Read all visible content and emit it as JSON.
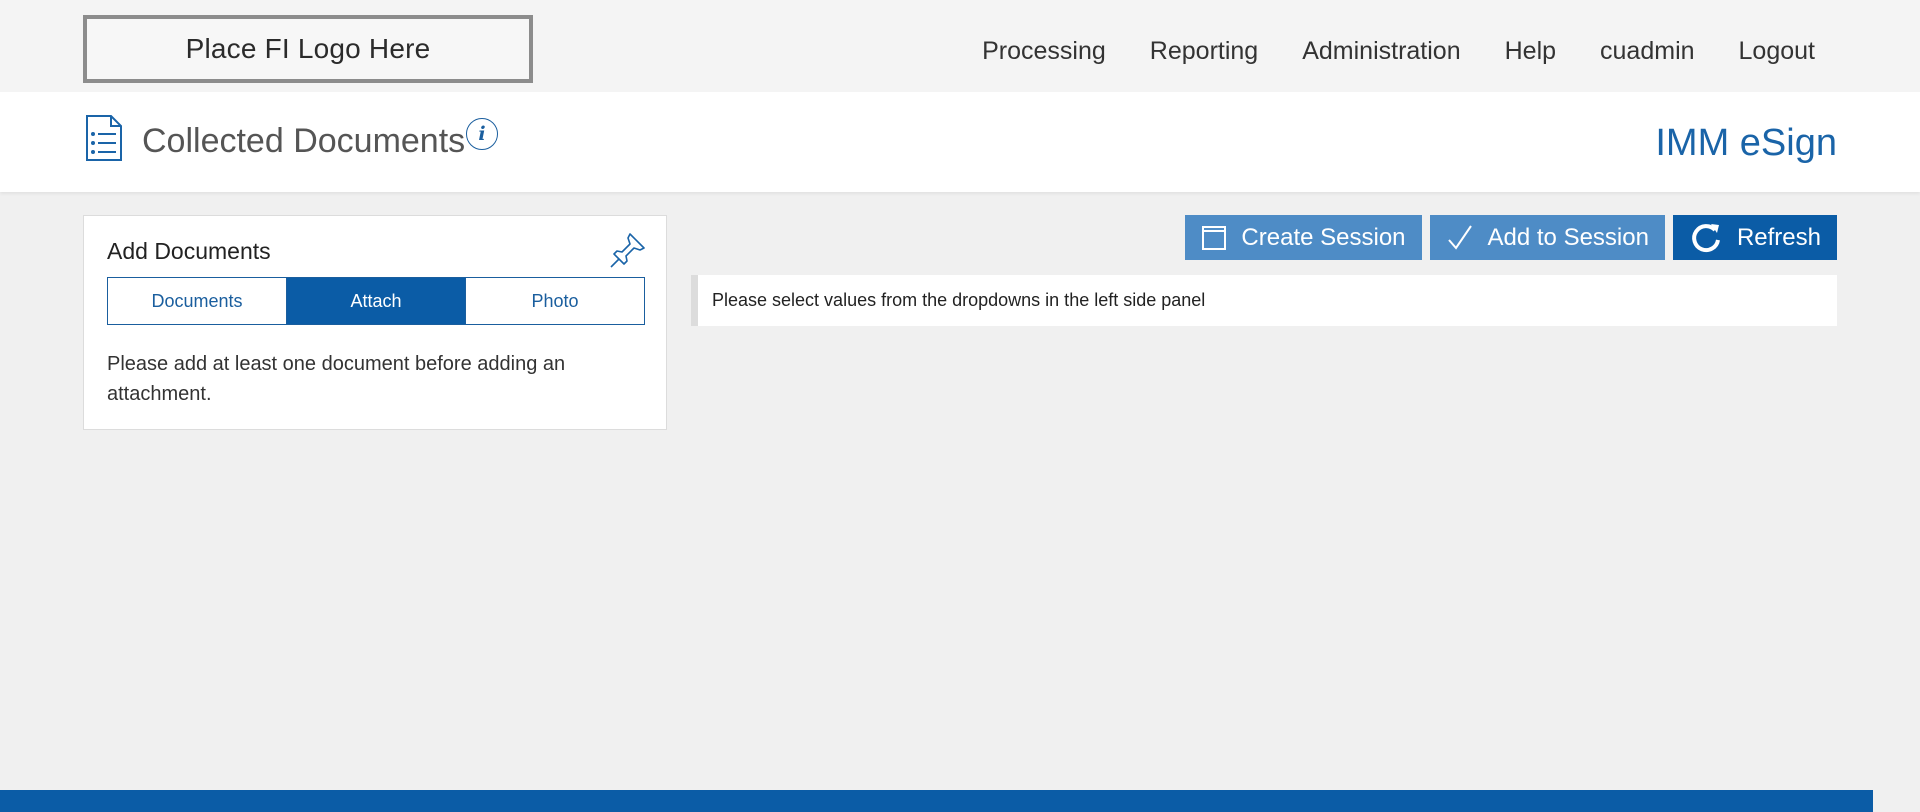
{
  "header": {
    "logo_text": "Place FI Logo Here",
    "nav": [
      {
        "label": "Processing"
      },
      {
        "label": "Reporting"
      },
      {
        "label": "Administration"
      },
      {
        "label": "Help"
      },
      {
        "label": "cuadmin"
      },
      {
        "label": "Logout"
      }
    ]
  },
  "page": {
    "title": "Collected Documents",
    "info_icon": "info-icon",
    "brand": "IMM eSign"
  },
  "panel": {
    "title": "Add Documents",
    "tabs": [
      {
        "label": "Documents",
        "active": false
      },
      {
        "label": "Attach",
        "active": true
      },
      {
        "label": "Photo",
        "active": false
      }
    ],
    "message": "Please add at least one document before adding an attachment."
  },
  "toolbar": {
    "create_session": "Create Session",
    "add_to_session": "Add to Session",
    "refresh": "Refresh"
  },
  "notice": {
    "text": "Please select values from the dropdowns in the left side panel"
  },
  "colors": {
    "primary": "#0b5ca6",
    "secondary_button": "#4e8cc6",
    "brand_text": "#1a64a8"
  }
}
